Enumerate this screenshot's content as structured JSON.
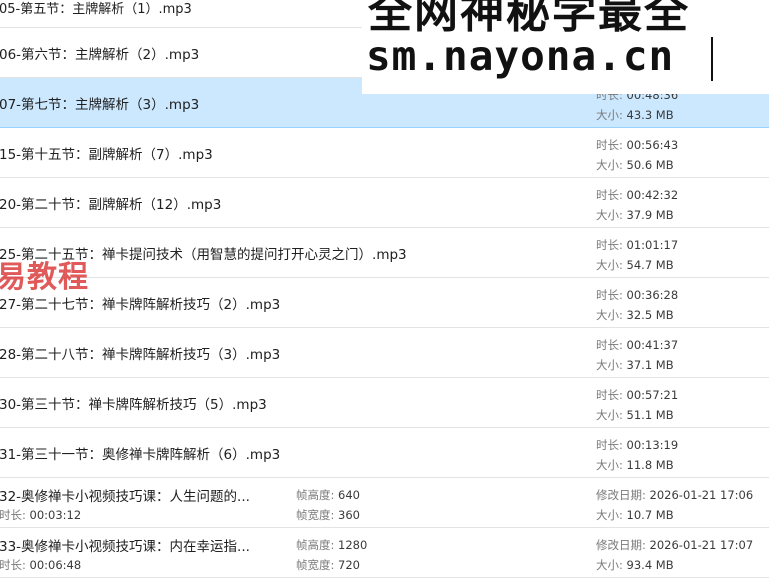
{
  "colors": {
    "selected_row": "#cce8ff",
    "row_border": "#e3e3e3",
    "label_gray": "#7a7a7a",
    "watermark_red": "#d82c2c"
  },
  "labels": {
    "duration": "时长: ",
    "size": "大小: ",
    "frame_height": "帧高度: ",
    "frame_width": "帧宽度: ",
    "modified": "修改日期: "
  },
  "files": [
    {
      "name": "05-第五节：主牌解析（1）.mp3",
      "duration": "",
      "size": "",
      "partial": true
    },
    {
      "name": "06-第六节：主牌解析（2）.mp3",
      "duration": "",
      "size": ""
    },
    {
      "name": "07-第七节：主牌解析（3）.mp3",
      "duration": "00:48:36",
      "size": "43.3 MB",
      "selected": true
    },
    {
      "name": "15-第十五节：副牌解析（7）.mp3",
      "duration": "00:56:43",
      "size": "50.6 MB"
    },
    {
      "name": "20-第二十节：副牌解析（12）.mp3",
      "duration": "00:42:32",
      "size": "37.9 MB"
    },
    {
      "name": "25-第二十五节：禅卡提问技术（用智慧的提问打开心灵之门）.mp3",
      "duration": "01:01:17",
      "size": "54.7 MB"
    },
    {
      "name": "27-第二十七节：禅卡牌阵解析技巧（2）.mp3",
      "duration": "00:36:28",
      "size": "32.5 MB"
    },
    {
      "name": "28-第二十八节：禅卡牌阵解析技巧（3）.mp3",
      "duration": "00:41:37",
      "size": "37.1 MB"
    },
    {
      "name": "30-第三十节：禅卡牌阵解析技巧（5）.mp3",
      "duration": "00:57:21",
      "size": "51.1 MB"
    },
    {
      "name": "31-第三十一节：奥修禅卡牌阵解析（6）.mp3",
      "duration": "00:13:19",
      "size": "11.8 MB"
    }
  ],
  "videos": [
    {
      "name": "32-奥修禅卡小视频技巧课：人生问题的...",
      "duration": "00:03:12",
      "frame_height": "640",
      "frame_width": "360",
      "modified": "2026-01-21 17:06",
      "size": "10.7 MB"
    },
    {
      "name": "33-奥修禅卡小视频技巧课：内在幸运指...",
      "duration": "00:06:48",
      "frame_height": "1280",
      "frame_width": "720",
      "modified": "2026-01-21 17:07",
      "size": "93.4 MB"
    }
  ],
  "watermark": {
    "line1": "全网神秘学最全",
    "line2": "sm.nayona.cn",
    "red_text": "易教程"
  }
}
